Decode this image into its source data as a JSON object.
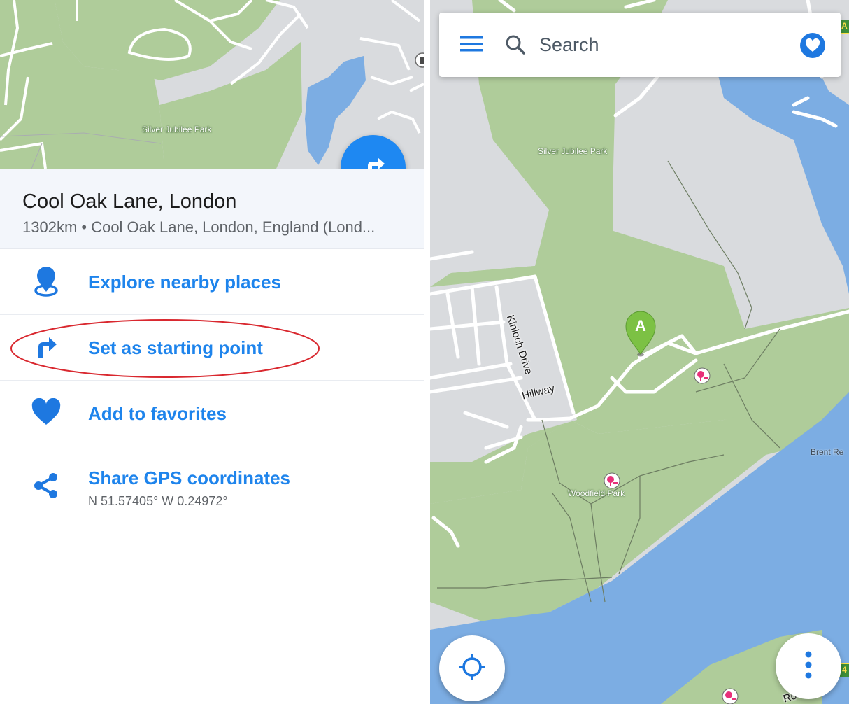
{
  "left": {
    "mini_map": {
      "park_label": "Silver Jubilee Park"
    },
    "place": {
      "title": "Cool Oak Lane, London",
      "subtitle": "1302km • Cool Oak Lane, London, England (Lond..."
    },
    "menu": [
      {
        "label": "Explore nearby places",
        "icon": "location-pin-icon"
      },
      {
        "label": "Set as starting point",
        "icon": "turn-right-arrow-icon",
        "highlighted": true
      },
      {
        "label": "Add to favorites",
        "icon": "heart-icon"
      },
      {
        "label": "Share GPS coordinates",
        "icon": "share-icon",
        "sub": "N 51.57405° W 0.24972°"
      }
    ]
  },
  "right": {
    "search": {
      "placeholder": "Search"
    },
    "map": {
      "labels": {
        "park1": "Silver Jubilee Park",
        "park2": "Woodfield Park",
        "street1": "Kinloch Drive",
        "street2": "Hillway",
        "reservoir": "Brent Re",
        "road_bottom": "Ro",
        "badge_top": "A",
        "badge_right": "4"
      },
      "marker_label": "A"
    }
  },
  "colors": {
    "accent": "#1e88f2",
    "park_green": "#afcc9a",
    "water_blue": "#7cade3",
    "land_gray": "#d9dbde",
    "marker_green": "#7cc144",
    "poi_pink": "#e8307a",
    "highlight_red": "#d9282f"
  }
}
